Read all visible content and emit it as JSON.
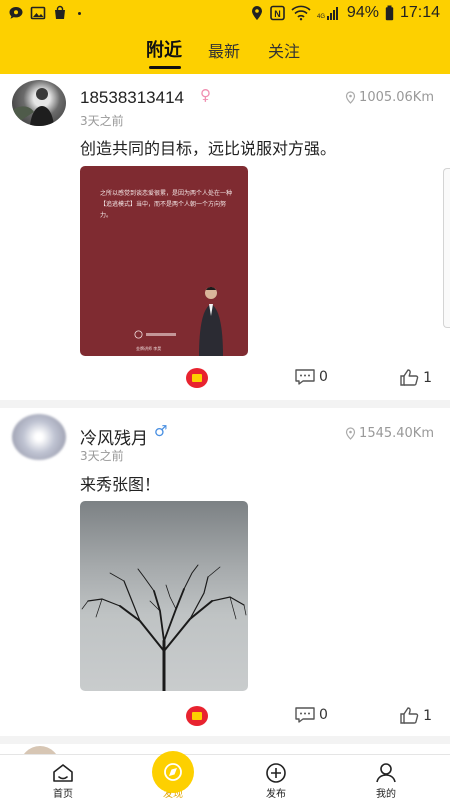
{
  "status_bar": {
    "battery": "94%",
    "time": "17:14",
    "network": "4G"
  },
  "tabs": [
    {
      "label": "附近",
      "active": true
    },
    {
      "label": "最新",
      "active": false
    },
    {
      "label": "关注",
      "active": false
    }
  ],
  "posts": [
    {
      "username": "18538313414",
      "gender": "female",
      "gender_symbol": "♀",
      "distance": "1005.06Km",
      "time": "3天之前",
      "content": "创造共同的目标，远比说服对方强。",
      "image_text": "之所以感觉到谈恋爱很累，是因为两个人处在一种【追逃模式】当中，而不是两个人朝一个方向努力。",
      "image_brand": "金牌讲师 李昊",
      "comments": "0",
      "likes": "1"
    },
    {
      "username": "冷风残月",
      "gender": "male",
      "gender_symbol": "♂",
      "distance": "1545.40Km",
      "time": "3天之前",
      "content": "来秀张图！",
      "comments": "0",
      "likes": "1"
    }
  ],
  "bottom_nav": [
    {
      "label": "首页",
      "icon": "home-icon",
      "active": false
    },
    {
      "label": "发现",
      "icon": "discover-icon",
      "active": true
    },
    {
      "label": "发布",
      "icon": "plus-circle-icon",
      "active": false
    },
    {
      "label": "我的",
      "icon": "user-icon",
      "active": false
    }
  ],
  "colors": {
    "brand_yellow": "#fdd000",
    "gift_red": "#e8232f",
    "female_pink": "#f08fb1",
    "male_blue": "#4a90e2"
  }
}
